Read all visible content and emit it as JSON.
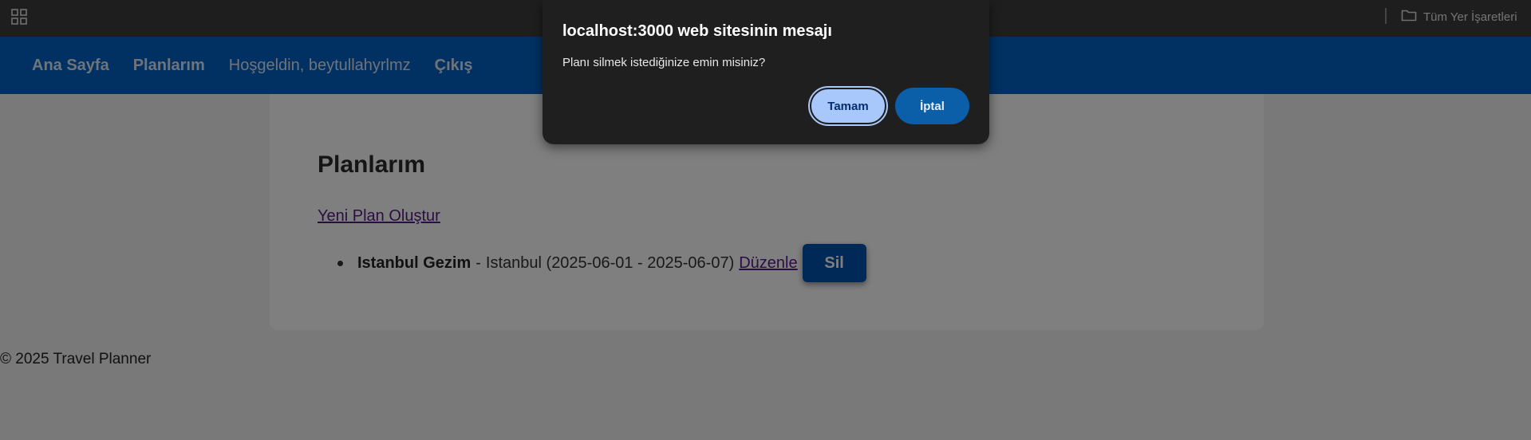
{
  "browser": {
    "apps_icon": "apps-grid-icon",
    "all_bookmarks_label": "Tüm Yer İşaretleri",
    "folder_icon": "folder-icon"
  },
  "nav": {
    "home": "Ana Sayfa",
    "plans": "Planlarım",
    "welcome": "Hoşgeldin, beytullahyrlmz",
    "logout": "Çıkış"
  },
  "main": {
    "title": "Planlarım",
    "new_plan_link": "Yeni Plan Oluştur",
    "plans": [
      {
        "name": "Istanbul Gezim",
        "details": "Istanbul (2025-06-01 - 2025-06-07)",
        "edit_label": "Düzenle",
        "delete_label": "Sil"
      }
    ]
  },
  "footer": {
    "text": "© 2025 Travel Planner"
  },
  "dialog": {
    "title": "localhost:3000 web sitesinin mesajı",
    "message": "Planı silmek istediğinize emin misiniz?",
    "ok_label": "Tamam",
    "cancel_label": "İptal"
  },
  "colors": {
    "nav_bg": "#0062c4",
    "delete_btn": "#0052b0",
    "dialog_bg": "#1f1f1f",
    "ok_btn": "#a8c7fa",
    "cancel_btn": "#0b5ea8"
  }
}
